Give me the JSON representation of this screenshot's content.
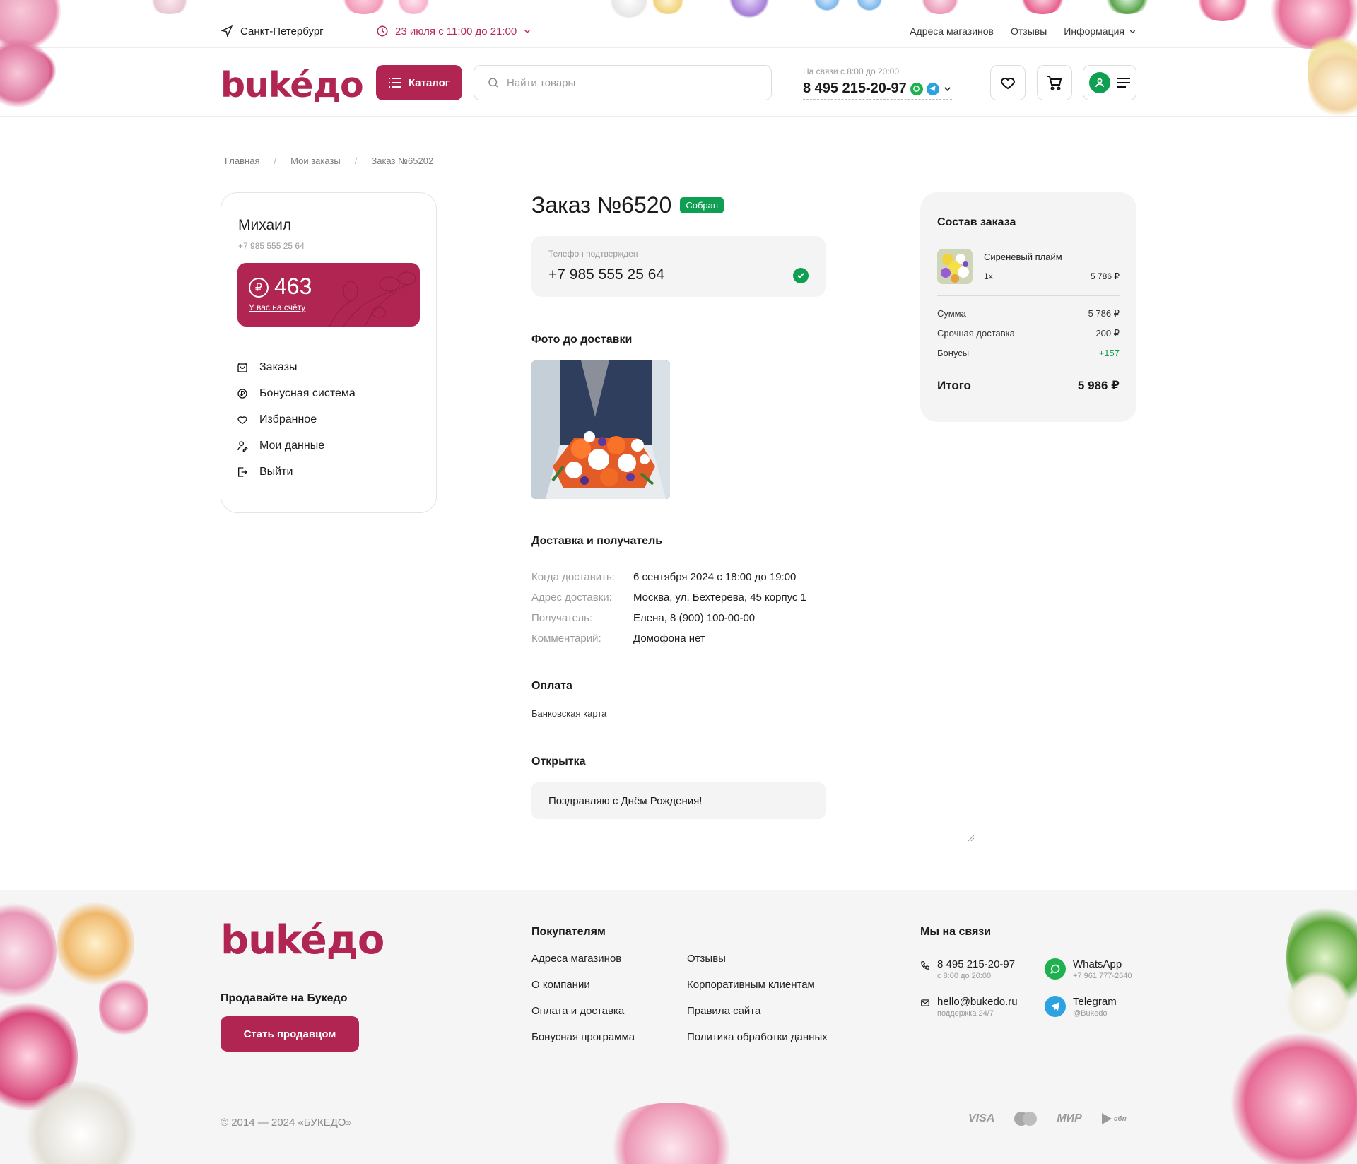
{
  "topbar": {
    "city": "Санкт-Петербург",
    "delivery_hours": "23 июля с 11:00 до 21:00",
    "links": [
      "Адреса магазинов",
      "Отзывы"
    ],
    "info_label": "Информация"
  },
  "header": {
    "logo": "bukéдo",
    "catalog_label": "Каталог",
    "search_placeholder": "Найти товары",
    "phone_hours": "На связи с 8:00 до 20:00",
    "phone": "8 495 215-20-97"
  },
  "breadcrumbs": [
    "Главная",
    "Мои заказы",
    "Заказ №65202"
  ],
  "profile": {
    "name": "Михаил",
    "phone": "+7 985 555 25 64",
    "bonus_value": "463",
    "bonus_currency": "₽",
    "bonus_link": "У вас на счёту",
    "menu": [
      "Заказы",
      "Бонусная система",
      "Избранное",
      "Мои данные",
      "Выйти"
    ]
  },
  "order": {
    "title": "Заказ №6520",
    "status": "Собран",
    "status_color": "#0e9f52",
    "phone_label": "Телефон подтвержден",
    "phone_value": "+7 985 555 25 64",
    "photo_heading": "Фото до доставки",
    "delivery_heading": "Доставка и получатель",
    "delivery": [
      {
        "key": "Когда доставить:",
        "value": "6 сентября 2024 с 18:00 до 19:00"
      },
      {
        "key": "Адрес доставки:",
        "value": "Москва, ул. Бехтерева, 45 корпус 1"
      },
      {
        "key": "Получатель:",
        "value": "Елена, 8 (900) 100-00-00"
      },
      {
        "key": "Комментарий:",
        "value": "Домофона нет"
      }
    ],
    "payment_heading": "Оплата",
    "payment_value": "Банковская карта",
    "card_heading": "Открытка",
    "card_text": "Поздравляю с Днём Рождения!"
  },
  "summary": {
    "title": "Состав заказа",
    "item_name": "Сиреневый плайм",
    "item_qty": "1х",
    "item_price": "5 786 ₽",
    "rows": [
      {
        "label": "Сумма",
        "value": "5 786 ₽"
      },
      {
        "label": "Срочная доставка",
        "value": "200 ₽"
      },
      {
        "label": "Бонусы",
        "value": "+157"
      }
    ],
    "total_label": "Итого",
    "total_value": "5 986 ₽"
  },
  "footer": {
    "logo": "bukéдo",
    "sell_heading": "Продавайте на Букедо",
    "sell_button": "Стать продавцом",
    "buyers_heading": "Покупателям",
    "links_col1": [
      "Адреса магазинов",
      "О компании",
      "Оплата и доставка",
      "Бонусная программа"
    ],
    "links_col2": [
      "Отзывы",
      "Корпоративным клиентам",
      "Правила сайта",
      "Политика обработки данных"
    ],
    "contacts_heading": "Мы на связи",
    "phone": "8 495 215-20-97",
    "phone_sub": "с 8:00 до 20:00",
    "email": "hello@bukedo.ru",
    "email_sub": "поддержка 24/7",
    "whatsapp": "WhatsApp",
    "whatsapp_sub": "+7 961 777-2640",
    "telegram": "Telegram",
    "telegram_sub": "@Bukedo",
    "copyright": "© 2014 — 2024 «БУКЕДО»",
    "payments": [
      "VISA",
      "МИР",
      "сбп"
    ]
  },
  "colors": {
    "brand": "#b02552",
    "accent_text": "#b72a57",
    "success": "#0e9f52",
    "bonus_positive": "#0e9f52"
  }
}
